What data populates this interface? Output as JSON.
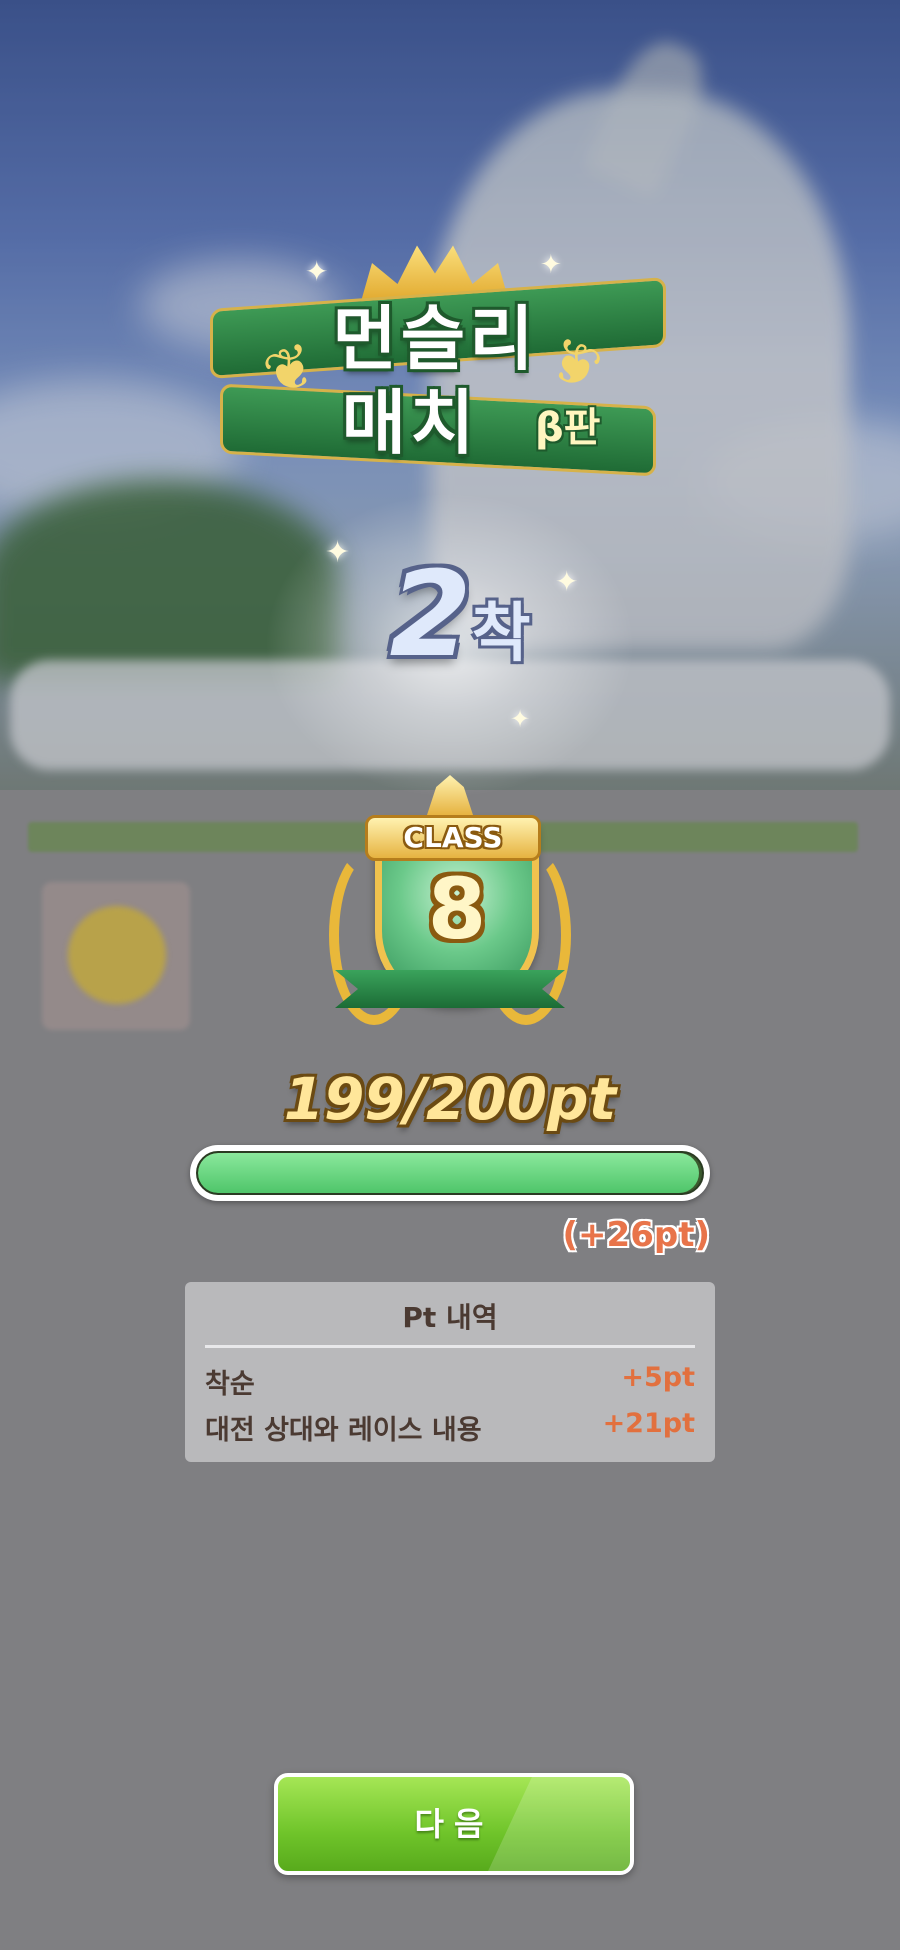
{
  "event_logo": {
    "line1": "먼슬리",
    "line2": "매치",
    "beta": "β판"
  },
  "result": {
    "placement_number": "2",
    "placement_suffix": "착"
  },
  "class_badge": {
    "word": "CLASS",
    "number": "8"
  },
  "points": {
    "text": "199/200pt",
    "current": 199,
    "max": 200,
    "gain": "(+26pt)"
  },
  "pt_history": {
    "title": "Pt 내역",
    "rows": [
      {
        "label": "착순",
        "value": "+5pt"
      },
      {
        "label": "대전 상대와 레이스 내용",
        "value": "+21pt"
      }
    ]
  },
  "next_button": {
    "label": "다음"
  },
  "colors": {
    "accent_green": "#6fc42a",
    "gain_orange": "#e8744a",
    "points_gold": "#ffe69a"
  }
}
